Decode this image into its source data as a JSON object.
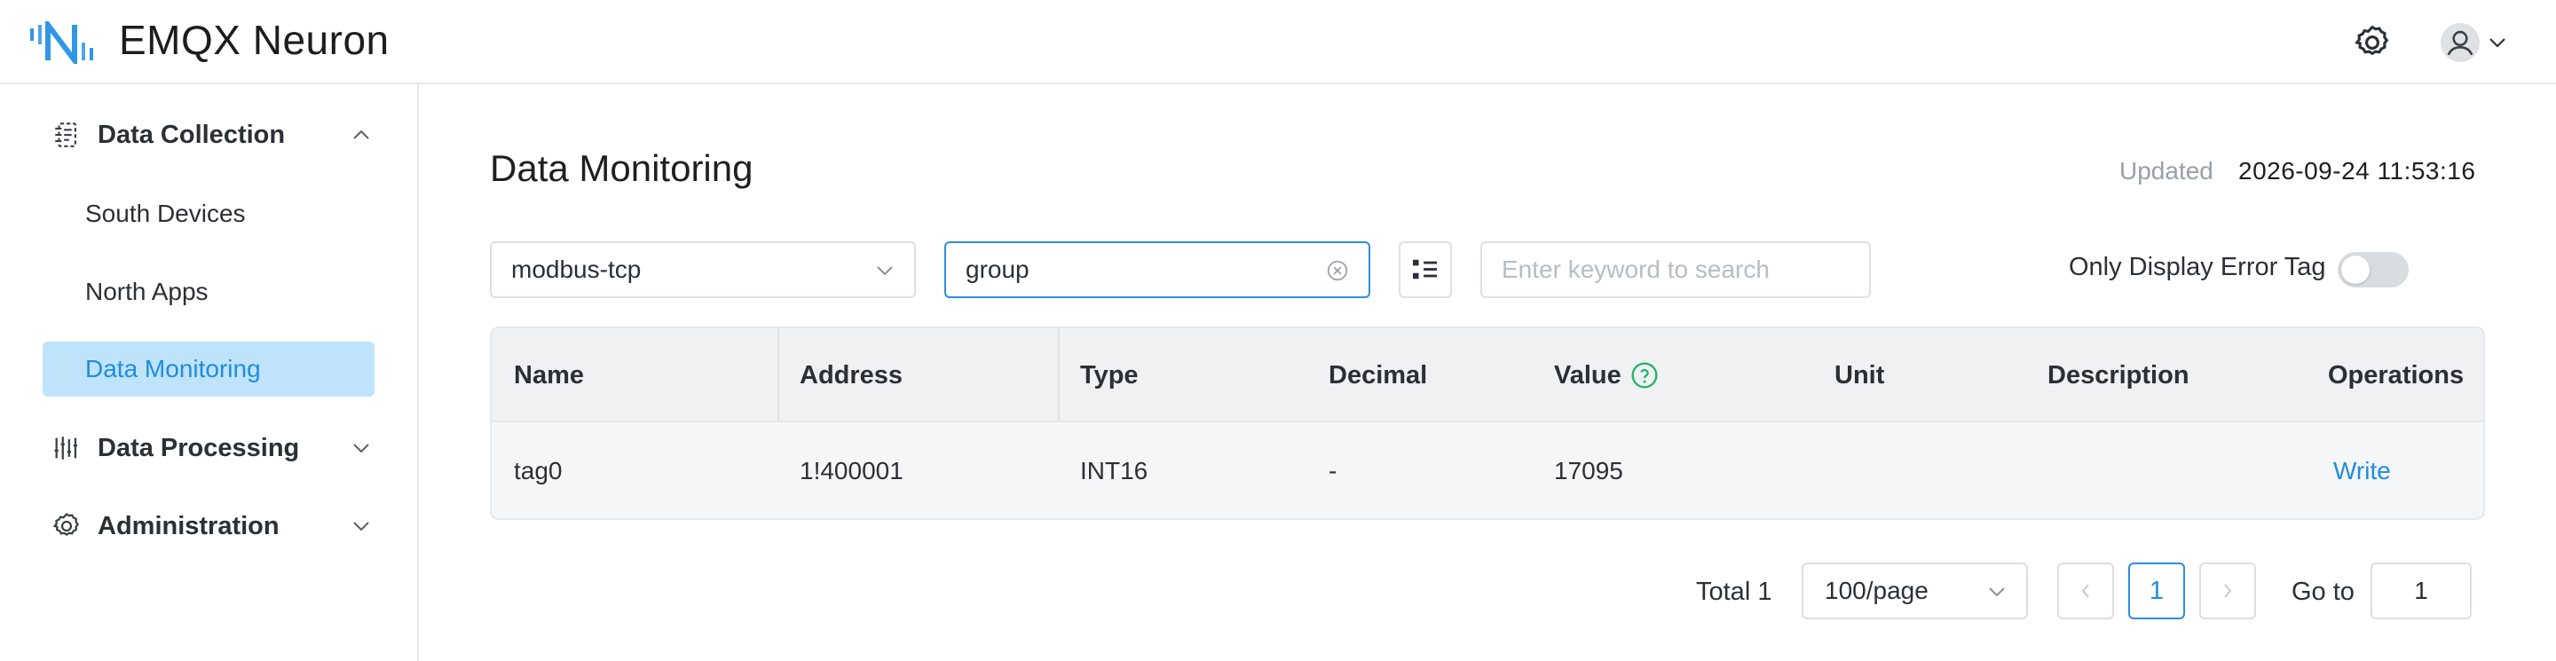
{
  "app": {
    "title": "EMQX Neuron"
  },
  "colors": {
    "accent": "#1e8de0",
    "logo_blue": "#2f97e8",
    "active_bg": "#bfe3fb"
  },
  "header": {
    "icons": [
      "gear-icon",
      "user-avatar-icon",
      "chevron-down-icon"
    ]
  },
  "sidebar": {
    "groups": [
      {
        "label": "Data Collection",
        "icon": "data-collection-icon",
        "expanded": true,
        "items": [
          {
            "label": "South Devices"
          },
          {
            "label": "North Apps"
          },
          {
            "label": "Data Monitoring",
            "active": true
          }
        ]
      },
      {
        "label": "Data Processing",
        "icon": "data-processing-icon",
        "expanded": false
      },
      {
        "label": "Administration",
        "icon": "gear-icon",
        "expanded": false
      }
    ]
  },
  "main": {
    "title": "Data Monitoring",
    "updated_label": "Updated",
    "updated_value": "2026-09-24 11:53:16",
    "filters": {
      "node": "modbus-tcp",
      "group": "group",
      "search_placeholder": "Enter keyword to search",
      "search_value": "",
      "error_toggle_label": "Only Display Error Tag",
      "error_toggle_on": false
    },
    "table": {
      "columns": [
        "Name",
        "Address",
        "Type",
        "Decimal",
        "Value",
        "Unit",
        "Description",
        "Operations"
      ],
      "rows": [
        {
          "name": "tag0",
          "address": "1!400001",
          "type": "INT16",
          "decimal": "-",
          "value": "17095",
          "unit": "",
          "description": "",
          "operation": "Write"
        }
      ]
    },
    "pagination": {
      "total_label": "Total 1",
      "page_size": "100/page",
      "current_page": "1",
      "goto_label": "Go to",
      "goto_value": "1"
    }
  }
}
